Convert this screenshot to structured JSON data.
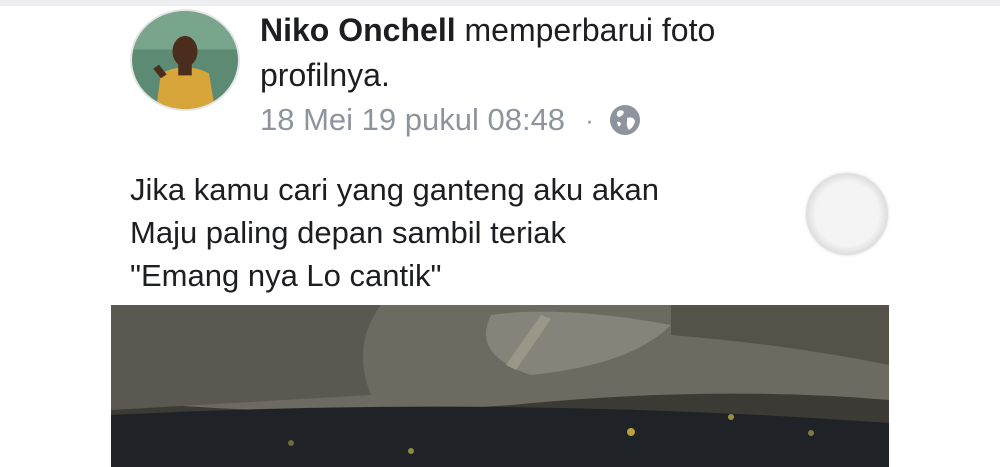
{
  "post": {
    "author": "Niko Onchell",
    "action_line1": " memperbarui foto",
    "action_line2": "profilnya.",
    "timestamp": "18 Mei 19 pukul 08:48",
    "separator": "·",
    "privacy_icon": "globe-icon",
    "text_lines": [
      "Jika kamu cari yang ganteng aku akan",
      "Maju paling depan sambil teriak",
      "\"Emang nya Lo cantik\""
    ]
  },
  "colors": {
    "text": "#1c1e21",
    "meta": "#8d949e"
  }
}
